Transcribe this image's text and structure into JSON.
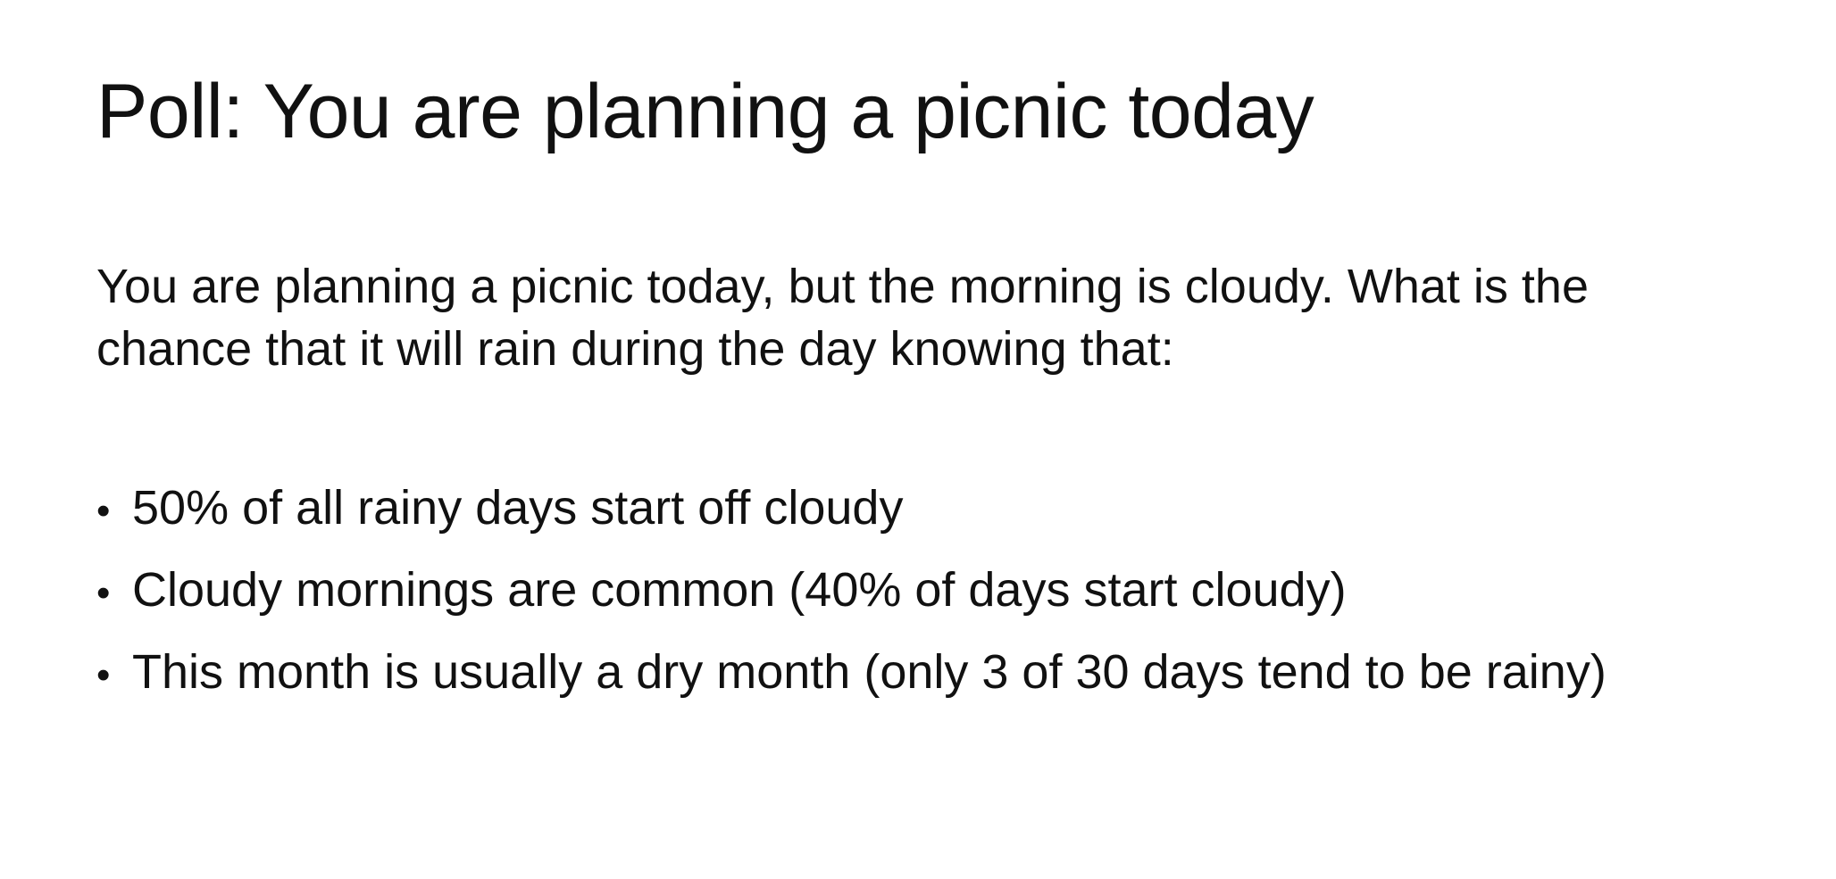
{
  "slide": {
    "title": "Poll: You are planning a picnic today",
    "intro_lines": [
      "You are planning a picnic today, but the morning is cloudy. What is the",
      "chance that it will rain during the day knowing that:"
    ],
    "bullets": [
      "50% of all rainy days start off cloudy",
      "Cloudy mornings are common (40% of days start cloudy)",
      "This month is usually a dry month (only 3 of 30 days tend to be rainy)"
    ],
    "bullet_glyph": "•"
  }
}
